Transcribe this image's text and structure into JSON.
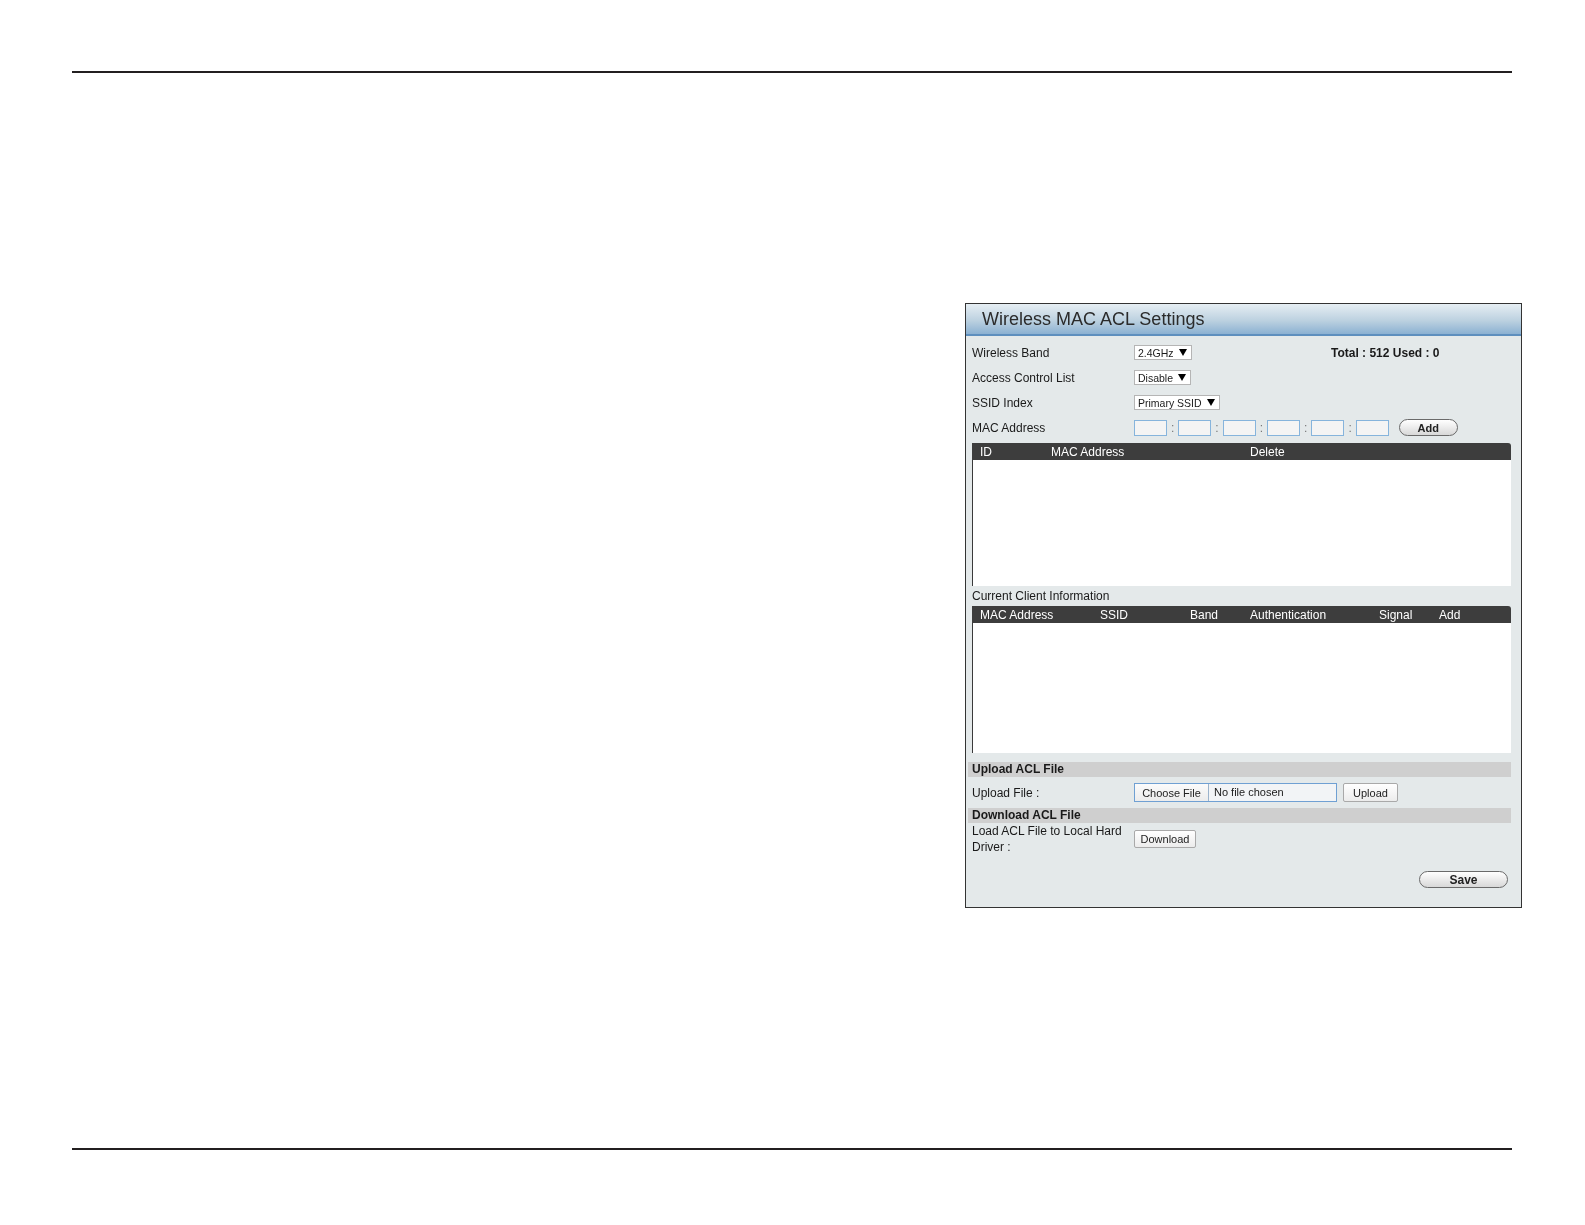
{
  "panel": {
    "title": "Wireless MAC ACL Settings",
    "settings": [
      {
        "kind": "select",
        "label": "Wireless Band",
        "value": "2.4GHz",
        "note": "Total : 512 Used : 0"
      },
      {
        "kind": "select",
        "label": "Access Control List",
        "value": "Disable"
      },
      {
        "kind": "select",
        "label": "SSID Index",
        "value": "Primary SSID"
      },
      {
        "kind": "mac",
        "label": "MAC Address",
        "separators": [
          ":",
          ":",
          ":",
          ":",
          ":"
        ],
        "button": "Add"
      }
    ],
    "acl_table": {
      "columns": [
        "ID",
        "MAC Address",
        "Delete"
      ]
    },
    "client_table": {
      "title": "Current Client Information",
      "columns": [
        "MAC Address",
        "SSID",
        "Band",
        "Authentication",
        "Signal",
        "Add"
      ]
    },
    "upload": {
      "heading": "Upload ACL File",
      "label": "Upload File :",
      "choose_button": "Choose File",
      "file_status": "No file chosen",
      "button": "Upload"
    },
    "download": {
      "heading": "Download ACL File",
      "label": "Load ACL File to Local Hard Driver :",
      "button": "Download"
    },
    "save_button": "Save"
  }
}
